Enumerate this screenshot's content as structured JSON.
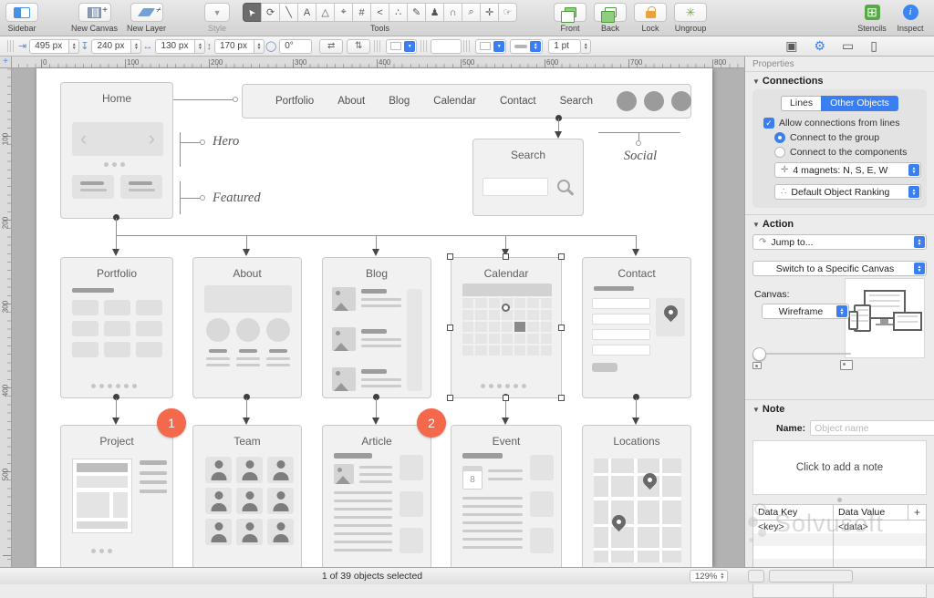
{
  "toolbar": {
    "sidebar": "Sidebar",
    "new_canvas": "New Canvas",
    "new_layer": "New Layer",
    "style": "Style",
    "tools": "Tools",
    "front": "Front",
    "back": "Back",
    "lock": "Lock",
    "ungroup": "Ungroup",
    "stencils": "Stencils",
    "inspect": "Inspect"
  },
  "geometry": {
    "x": "495 px",
    "y": "240 px",
    "width": "130 px",
    "height": "170 px",
    "rotation": "0°",
    "stroke_width": "1 pt"
  },
  "rulers": {
    "h": [
      "0",
      "100",
      "200",
      "300",
      "400",
      "500",
      "600",
      "700",
      "800"
    ],
    "v": [
      "100",
      "200",
      "300",
      "400",
      "500"
    ]
  },
  "sitemap": {
    "home": "Home",
    "nav_items": [
      "Portfolio",
      "About",
      "Blog",
      "Calendar",
      "Contact",
      "Search"
    ],
    "search": "Search",
    "hero": "Hero",
    "featured": "Featured",
    "social": "Social",
    "level2": [
      "Portfolio",
      "About",
      "Blog",
      "Calendar",
      "Contact"
    ],
    "level3": [
      "Project",
      "Team",
      "Article",
      "Event",
      "Locations"
    ],
    "badge1": "1",
    "badge2": "2",
    "event_day": "8"
  },
  "inspector": {
    "properties": "Properties",
    "connections": {
      "title": "Connections",
      "tab_lines": "Lines",
      "tab_other": "Other Objects",
      "allow": "Allow connections from lines",
      "to_group": "Connect to the group",
      "to_components": "Connect to the components",
      "magnets": "4 magnets: N, S, E, W",
      "ranking": "Default Object Ranking"
    },
    "action": {
      "title": "Action",
      "jump": "Jump to...",
      "switch": "Switch to a Specific Canvas",
      "canvas_label": "Canvas:",
      "canvas_value": "Wireframe"
    },
    "note": {
      "title": "Note",
      "name_label": "Name:",
      "name_placeholder": "Object name",
      "placeholder": "Click to add a note",
      "col_key": "Data Key",
      "col_value": "Data Value",
      "add": "+",
      "row_key": "<key>",
      "row_value": "<data>"
    }
  },
  "status": {
    "selection": "1 of 39 objects selected",
    "zoom": "129%"
  },
  "watermark": "Solvusoft",
  "colors": {
    "accent": "#3b7ef2",
    "toolbar_green": "#57a946",
    "lock_orange": "#e8a43c",
    "badge_orange": "#f4684b",
    "selection_handles": "#4e4e4e"
  }
}
